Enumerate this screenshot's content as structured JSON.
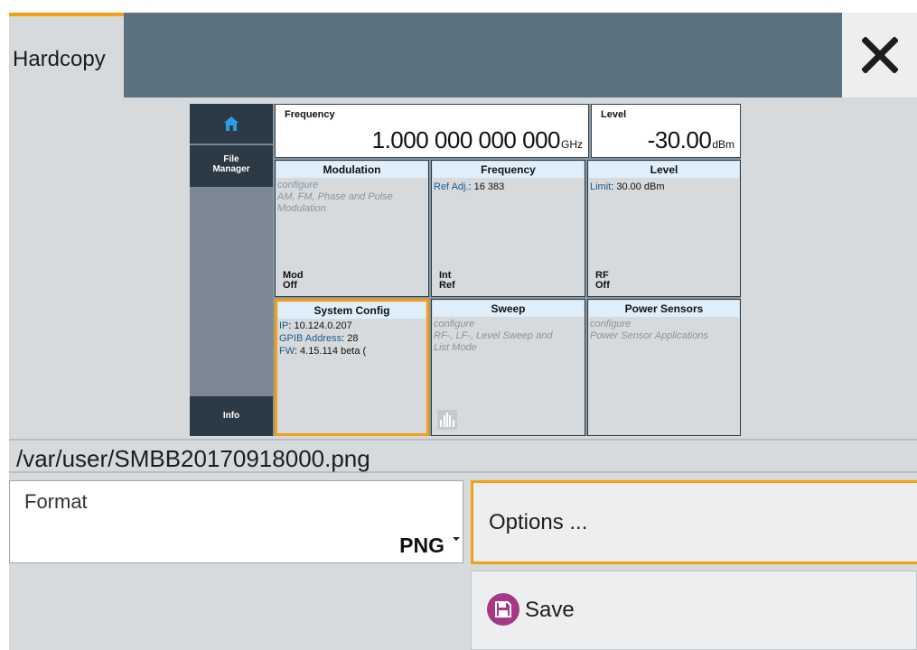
{
  "dialog": {
    "title": "Hardcopy",
    "close_icon": "close-icon"
  },
  "preview": {
    "sidebar": {
      "home_icon": "home-icon",
      "file_manager": "File Manager",
      "info": "Info"
    },
    "header": {
      "frequency": {
        "label": "Frequency",
        "value": "1.000 000 000 000",
        "unit": "GHz"
      },
      "level": {
        "label": "Level",
        "value": "-30.00",
        "unit": "dBm"
      }
    },
    "tiles": [
      {
        "title": "Modulation",
        "desc": "configure\nAM, FM, Phase and Pulse\nModulation",
        "state_line1": "Mod",
        "state_line2": "Off"
      },
      {
        "title": "Frequency",
        "key1": "Ref Adj.",
        "val1": ": 16 383",
        "state_line1": "Int",
        "state_line2": "Ref"
      },
      {
        "title": "Level",
        "key1": "Limit",
        "val1": ": 30.00 dBm",
        "state_line1": "RF",
        "state_line2": "Off"
      },
      {
        "title": "System Config",
        "key1": "IP",
        "val1": ": 10.124.0.207",
        "key2": "GPIB Address",
        "val2": ": 28",
        "key3": "FW",
        "val3": ": 4.15.114 beta ("
      },
      {
        "title": "Sweep",
        "desc": "configure\nRF-, LF-, Level Sweep and\nList Mode",
        "icon": "sweep-icon"
      },
      {
        "title": "Power Sensors",
        "desc": "configure\nPower Sensor Applications"
      }
    ]
  },
  "path": "/var/user/SMBB20170918000.png",
  "format": {
    "label": "Format",
    "value": "PNG"
  },
  "buttons": {
    "options": "Options ...",
    "save": "Save",
    "save_icon": "floppy-disk-icon"
  },
  "colors": {
    "accent": "#f5a011",
    "titlebar": "#5b7180",
    "save_icon_bg": "#a43a86"
  }
}
